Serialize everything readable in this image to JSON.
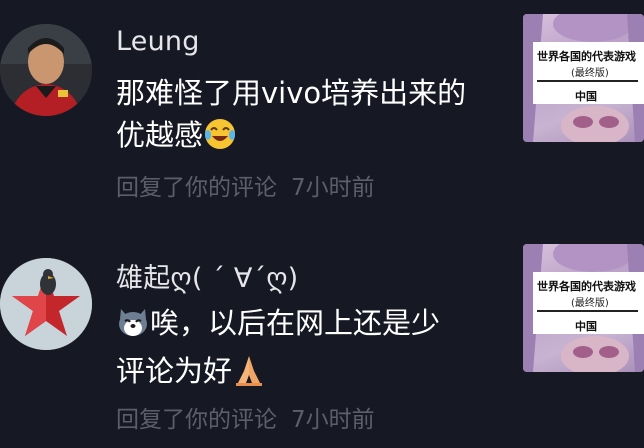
{
  "notifications": [
    {
      "username": "Leung",
      "content_line1": "那难怪了用vivo培养出来的",
      "content_line2": "优越感",
      "emoji_end": "crying-laughing-emoji",
      "action": "回复了你的评论",
      "time": "7小时前",
      "thumb": {
        "title": "世界各国的代表游戏",
        "subtitle": "(最终版)",
        "label": "中国"
      }
    },
    {
      "username": "雄起ღ( ´ ∀´ღ)",
      "emoji_start": "husky-dog-emoji",
      "content_line1": "唉，以后在网上还是少",
      "content_line2": "评论为好",
      "emoji_end": "praying-hands-emoji",
      "action": "回复了你的评论",
      "time": "7小时前",
      "thumb": {
        "title": "世界各国的代表游戏",
        "subtitle": "(最终版)",
        "label": "中国"
      }
    }
  ]
}
